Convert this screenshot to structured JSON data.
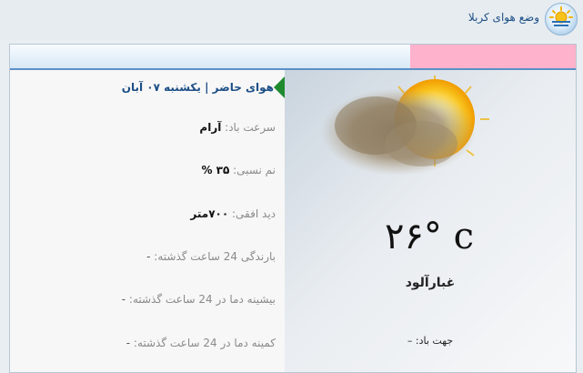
{
  "header": {
    "title": "وضع هوای کربلا",
    "icon": "weather-sun-icon"
  },
  "colors": {
    "title_blue": "#1c4e86",
    "topbar_pink": "#ffb2cc",
    "arrow_green": "#1f8a2e"
  },
  "current": {
    "heading": "هوای حاضر | یکشنبه ۰۷ آبان",
    "wind_speed": {
      "label": "سرعت باد:",
      "value": "آرام"
    },
    "humidity": {
      "label": "نم نسبی:",
      "value": "۳۵ %"
    },
    "visibility": {
      "label": "دید افقی:",
      "value": "۷۰۰متر"
    },
    "rain_24h": {
      "label": "بارندگی 24 ساعت گذشته:",
      "value": "-"
    },
    "max_temp_24h": {
      "label": "بیشینه دما در 24 ساعت گذشته:",
      "value": "-"
    },
    "min_temp_24h": {
      "label": "کمینه دما در 24 ساعت گذشته:",
      "value": "-"
    }
  },
  "visual": {
    "icon": "dusty-sun-icon",
    "temperature": "۲۶° c",
    "condition": "غبارآلود",
    "wind_direction": "جهت باد: –"
  }
}
